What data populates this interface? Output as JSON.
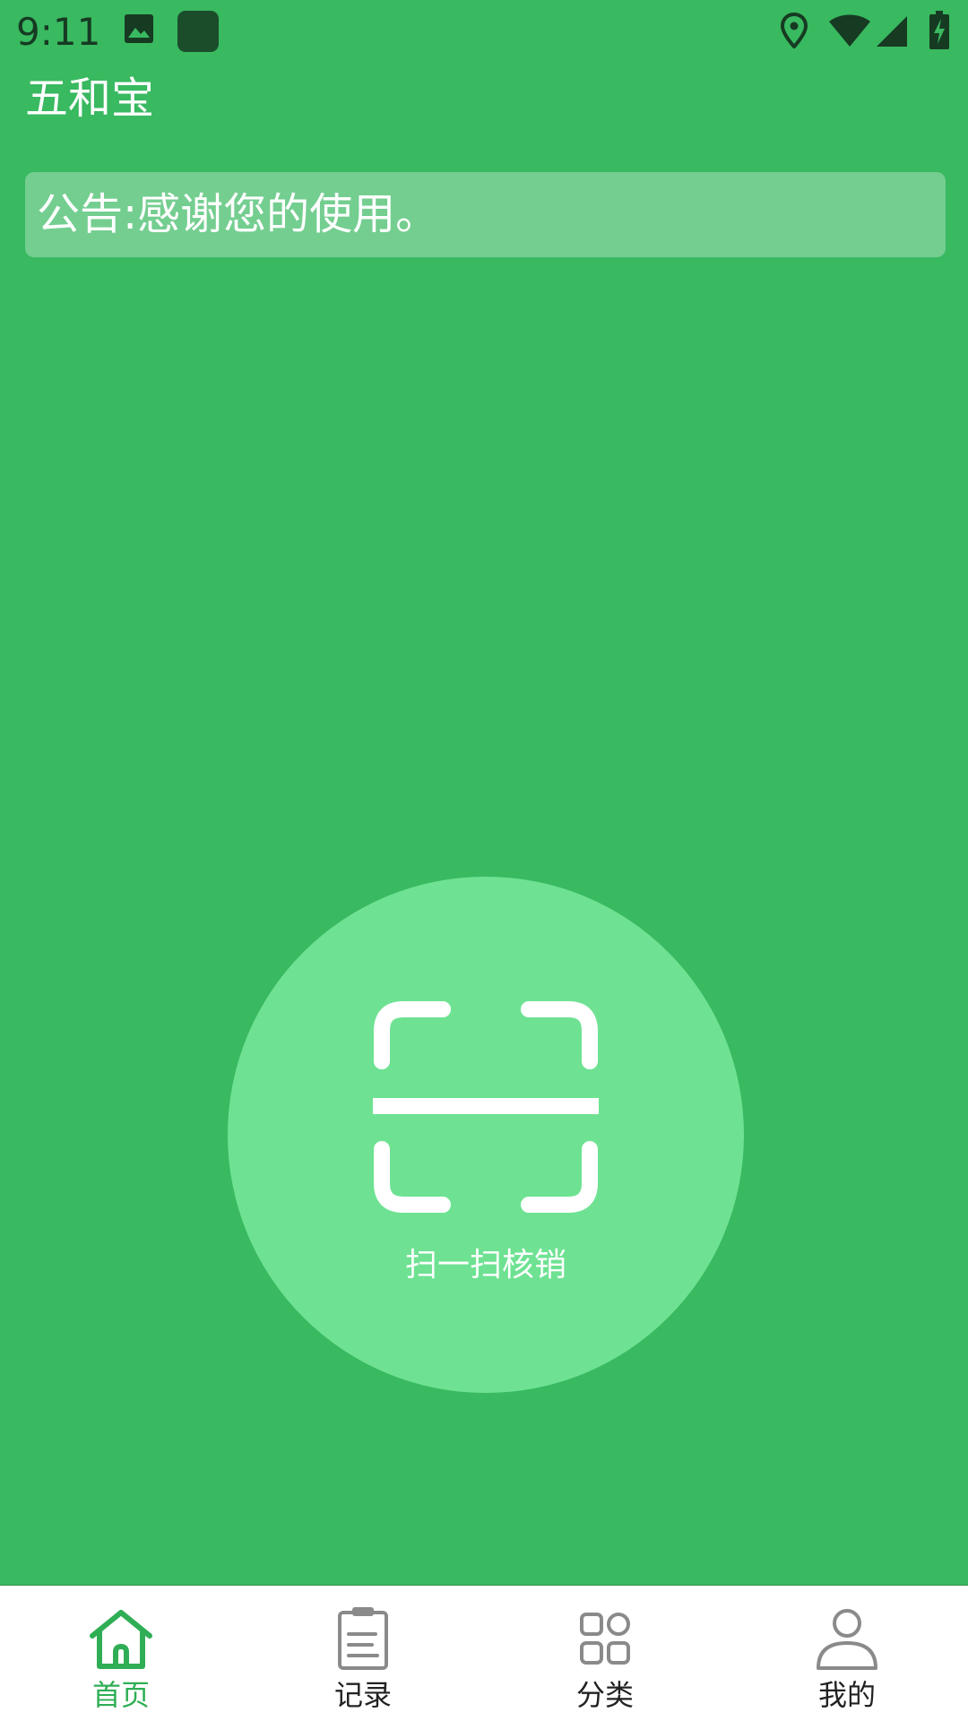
{
  "status_bar": {
    "time": "9:11",
    "left_icons": [
      "image-icon",
      "app-square-icon"
    ],
    "right_icons": [
      "location-icon",
      "wifi-icon",
      "signal-icon",
      "battery-charging-icon"
    ]
  },
  "app": {
    "title": "五和宝"
  },
  "notice": {
    "text": "公告:感谢您的使用。"
  },
  "scan": {
    "label": "扫一扫核销",
    "icon": "scan-icon"
  },
  "bottom_nav": {
    "items": [
      {
        "label": "首页",
        "icon": "home-icon",
        "active": true
      },
      {
        "label": "记录",
        "icon": "clipboard-icon",
        "active": false
      },
      {
        "label": "分类",
        "icon": "category-grid-icon",
        "active": false
      },
      {
        "label": "我的",
        "icon": "user-icon",
        "active": false
      }
    ]
  },
  "colors": {
    "background": "#39b960",
    "scan_circle": "#6ee292",
    "active_tab": "#2fae55",
    "status_icons": "#163a22"
  }
}
